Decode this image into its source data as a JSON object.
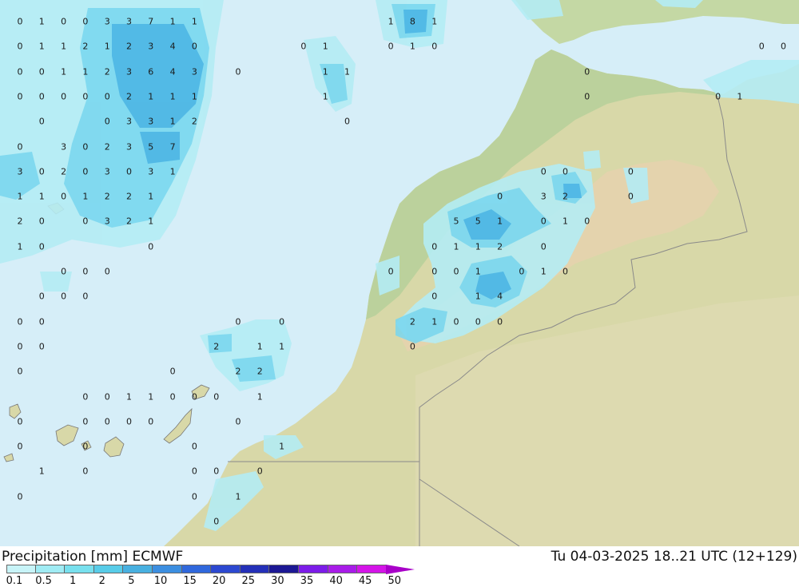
{
  "footer": {
    "title": "Precipitation [mm] ECMWF",
    "datetime": "Tu 04-03-2025 18..21 UTC (12+129)"
  },
  "colors": {
    "sea": "#d6eef8",
    "land": "#d8d8a8",
    "land_green": "#b8d09a",
    "mountain": "#e6d2ae",
    "border": "#8a8a8a"
  },
  "legend": {
    "ticks": [
      "0.1",
      "0.5",
      "1",
      "2",
      "5",
      "10",
      "15",
      "20",
      "25",
      "30",
      "35",
      "40",
      "45",
      "50"
    ],
    "colors": [
      "#c8f4f8",
      "#a0ecf4",
      "#78e0ee",
      "#58cce8",
      "#48b0e0",
      "#3c8ee0",
      "#3068dc",
      "#2c48d0",
      "#2430b8",
      "#1c1894",
      "#7c1ce8",
      "#a81ce8",
      "#d414e8",
      "#ec10d8",
      "#b010b0"
    ]
  },
  "grid_values": [
    {
      "v": "0",
      "row": 0,
      "col": 0
    },
    {
      "v": "1",
      "row": 0,
      "col": 1
    },
    {
      "v": "0",
      "row": 0,
      "col": 2
    },
    {
      "v": "0",
      "row": 0,
      "col": 3
    },
    {
      "v": "3",
      "row": 0,
      "col": 4
    },
    {
      "v": "3",
      "row": 0,
      "col": 5
    },
    {
      "v": "7",
      "row": 0,
      "col": 6
    },
    {
      "v": "1",
      "row": 0,
      "col": 7
    },
    {
      "v": "1",
      "row": 0,
      "col": 8
    },
    {
      "v": "1",
      "row": 0,
      "col": 17
    },
    {
      "v": "8",
      "row": 0,
      "col": 18
    },
    {
      "v": "1",
      "row": 0,
      "col": 19
    },
    {
      "v": "0",
      "row": 1,
      "col": 0
    },
    {
      "v": "1",
      "row": 1,
      "col": 1
    },
    {
      "v": "1",
      "row": 1,
      "col": 2
    },
    {
      "v": "2",
      "row": 1,
      "col": 3
    },
    {
      "v": "1",
      "row": 1,
      "col": 4
    },
    {
      "v": "2",
      "row": 1,
      "col": 5
    },
    {
      "v": "3",
      "row": 1,
      "col": 6
    },
    {
      "v": "4",
      "row": 1,
      "col": 7
    },
    {
      "v": "0",
      "row": 1,
      "col": 8
    },
    {
      "v": "0",
      "row": 1,
      "col": 13
    },
    {
      "v": "1",
      "row": 1,
      "col": 14
    },
    {
      "v": "0",
      "row": 1,
      "col": 17
    },
    {
      "v": "1",
      "row": 1,
      "col": 18
    },
    {
      "v": "0",
      "row": 1,
      "col": 19
    },
    {
      "v": "0",
      "row": 1,
      "col": 34
    },
    {
      "v": "0",
      "row": 1,
      "col": 35
    },
    {
      "v": "0",
      "row": 2,
      "col": 0
    },
    {
      "v": "0",
      "row": 2,
      "col": 1
    },
    {
      "v": "1",
      "row": 2,
      "col": 2
    },
    {
      "v": "1",
      "row": 2,
      "col": 3
    },
    {
      "v": "2",
      "row": 2,
      "col": 4
    },
    {
      "v": "3",
      "row": 2,
      "col": 5
    },
    {
      "v": "6",
      "row": 2,
      "col": 6
    },
    {
      "v": "4",
      "row": 2,
      "col": 7
    },
    {
      "v": "3",
      "row": 2,
      "col": 8
    },
    {
      "v": "0",
      "row": 2,
      "col": 10
    },
    {
      "v": "1",
      "row": 2,
      "col": 14
    },
    {
      "v": "1",
      "row": 2,
      "col": 15
    },
    {
      "v": "0",
      "row": 2,
      "col": 26
    },
    {
      "v": "0",
      "row": 3,
      "col": 0
    },
    {
      "v": "0",
      "row": 3,
      "col": 1
    },
    {
      "v": "0",
      "row": 3,
      "col": 2
    },
    {
      "v": "0",
      "row": 3,
      "col": 3
    },
    {
      "v": "0",
      "row": 3,
      "col": 4
    },
    {
      "v": "2",
      "row": 3,
      "col": 5
    },
    {
      "v": "1",
      "row": 3,
      "col": 6
    },
    {
      "v": "1",
      "row": 3,
      "col": 7
    },
    {
      "v": "1",
      "row": 3,
      "col": 8
    },
    {
      "v": "1",
      "row": 3,
      "col": 14
    },
    {
      "v": "0",
      "row": 3,
      "col": 26
    },
    {
      "v": "0",
      "row": 3,
      "col": 32
    },
    {
      "v": "1",
      "row": 3,
      "col": 33
    },
    {
      "v": "0",
      "row": 4,
      "col": 1
    },
    {
      "v": "0",
      "row": 4,
      "col": 4
    },
    {
      "v": "3",
      "row": 4,
      "col": 5
    },
    {
      "v": "3",
      "row": 4,
      "col": 6
    },
    {
      "v": "1",
      "row": 4,
      "col": 7
    },
    {
      "v": "2",
      "row": 4,
      "col": 8
    },
    {
      "v": "0",
      "row": 4,
      "col": 15
    },
    {
      "v": "0",
      "row": 5,
      "col": 0
    },
    {
      "v": "3",
      "row": 5,
      "col": 2
    },
    {
      "v": "0",
      "row": 5,
      "col": 3
    },
    {
      "v": "2",
      "row": 5,
      "col": 4
    },
    {
      "v": "3",
      "row": 5,
      "col": 5
    },
    {
      "v": "5",
      "row": 5,
      "col": 6
    },
    {
      "v": "7",
      "row": 5,
      "col": 7
    },
    {
      "v": "3",
      "row": 6,
      "col": 0
    },
    {
      "v": "0",
      "row": 6,
      "col": 1
    },
    {
      "v": "2",
      "row": 6,
      "col": 2
    },
    {
      "v": "0",
      "row": 6,
      "col": 3
    },
    {
      "v": "3",
      "row": 6,
      "col": 4
    },
    {
      "v": "0",
      "row": 6,
      "col": 5
    },
    {
      "v": "3",
      "row": 6,
      "col": 6
    },
    {
      "v": "1",
      "row": 6,
      "col": 7
    },
    {
      "v": "0",
      "row": 6,
      "col": 24
    },
    {
      "v": "0",
      "row": 6,
      "col": 25
    },
    {
      "v": "0",
      "row": 6,
      "col": 28
    },
    {
      "v": "1",
      "row": 7,
      "col": 0
    },
    {
      "v": "1",
      "row": 7,
      "col": 1
    },
    {
      "v": "0",
      "row": 7,
      "col": 2
    },
    {
      "v": "1",
      "row": 7,
      "col": 3
    },
    {
      "v": "2",
      "row": 7,
      "col": 4
    },
    {
      "v": "2",
      "row": 7,
      "col": 5
    },
    {
      "v": "1",
      "row": 7,
      "col": 6
    },
    {
      "v": "0",
      "row": 7,
      "col": 22
    },
    {
      "v": "3",
      "row": 7,
      "col": 24
    },
    {
      "v": "2",
      "row": 7,
      "col": 25
    },
    {
      "v": "0",
      "row": 7,
      "col": 28
    },
    {
      "v": "2",
      "row": 8,
      "col": 0
    },
    {
      "v": "0",
      "row": 8,
      "col": 1
    },
    {
      "v": "0",
      "row": 8,
      "col": 3
    },
    {
      "v": "3",
      "row": 8,
      "col": 4
    },
    {
      "v": "2",
      "row": 8,
      "col": 5
    },
    {
      "v": "1",
      "row": 8,
      "col": 6
    },
    {
      "v": "5",
      "row": 8,
      "col": 20
    },
    {
      "v": "5",
      "row": 8,
      "col": 21
    },
    {
      "v": "1",
      "row": 8,
      "col": 22
    },
    {
      "v": "0",
      "row": 8,
      "col": 24
    },
    {
      "v": "1",
      "row": 8,
      "col": 25
    },
    {
      "v": "0",
      "row": 8,
      "col": 26
    },
    {
      "v": "1",
      "row": 9,
      "col": 0
    },
    {
      "v": "0",
      "row": 9,
      "col": 1
    },
    {
      "v": "0",
      "row": 9,
      "col": 6
    },
    {
      "v": "0",
      "row": 9,
      "col": 19
    },
    {
      "v": "1",
      "row": 9,
      "col": 20
    },
    {
      "v": "1",
      "row": 9,
      "col": 21
    },
    {
      "v": "2",
      "row": 9,
      "col": 22
    },
    {
      "v": "0",
      "row": 9,
      "col": 24
    },
    {
      "v": "0",
      "row": 10,
      "col": 2
    },
    {
      "v": "0",
      "row": 10,
      "col": 3
    },
    {
      "v": "0",
      "row": 10,
      "col": 4
    },
    {
      "v": "0",
      "row": 10,
      "col": 17
    },
    {
      "v": "0",
      "row": 10,
      "col": 19
    },
    {
      "v": "0",
      "row": 10,
      "col": 20
    },
    {
      "v": "1",
      "row": 10,
      "col": 21
    },
    {
      "v": "0",
      "row": 10,
      "col": 23
    },
    {
      "v": "1",
      "row": 10,
      "col": 24
    },
    {
      "v": "0",
      "row": 10,
      "col": 25
    },
    {
      "v": "0",
      "row": 11,
      "col": 1
    },
    {
      "v": "0",
      "row": 11,
      "col": 2
    },
    {
      "v": "0",
      "row": 11,
      "col": 3
    },
    {
      "v": "0",
      "row": 11,
      "col": 19
    },
    {
      "v": "1",
      "row": 11,
      "col": 21
    },
    {
      "v": "4",
      "row": 11,
      "col": 22
    },
    {
      "v": "0",
      "row": 12,
      "col": 0
    },
    {
      "v": "0",
      "row": 12,
      "col": 1
    },
    {
      "v": "0",
      "row": 12,
      "col": 10
    },
    {
      "v": "0",
      "row": 12,
      "col": 12
    },
    {
      "v": "2",
      "row": 12,
      "col": 18
    },
    {
      "v": "1",
      "row": 12,
      "col": 19
    },
    {
      "v": "0",
      "row": 12,
      "col": 20
    },
    {
      "v": "0",
      "row": 12,
      "col": 21
    },
    {
      "v": "0",
      "row": 12,
      "col": 22
    },
    {
      "v": "0",
      "row": 13,
      "col": 0
    },
    {
      "v": "0",
      "row": 13,
      "col": 1
    },
    {
      "v": "2",
      "row": 13,
      "col": 9
    },
    {
      "v": "1",
      "row": 13,
      "col": 11
    },
    {
      "v": "1",
      "row": 13,
      "col": 12
    },
    {
      "v": "0",
      "row": 13,
      "col": 18
    },
    {
      "v": "0",
      "row": 14,
      "col": 0
    },
    {
      "v": "0",
      "row": 14,
      "col": 7
    },
    {
      "v": "2",
      "row": 14,
      "col": 10
    },
    {
      "v": "2",
      "row": 14,
      "col": 11
    },
    {
      "v": "0",
      "row": 15,
      "col": 3
    },
    {
      "v": "0",
      "row": 15,
      "col": 4
    },
    {
      "v": "1",
      "row": 15,
      "col": 5
    },
    {
      "v": "1",
      "row": 15,
      "col": 6
    },
    {
      "v": "0",
      "row": 15,
      "col": 7
    },
    {
      "v": "0",
      "row": 15,
      "col": 8
    },
    {
      "v": "0",
      "row": 15,
      "col": 9
    },
    {
      "v": "1",
      "row": 15,
      "col": 11
    },
    {
      "v": "0",
      "row": 16,
      "col": 0
    },
    {
      "v": "0",
      "row": 16,
      "col": 3
    },
    {
      "v": "0",
      "row": 16,
      "col": 4
    },
    {
      "v": "0",
      "row": 16,
      "col": 5
    },
    {
      "v": "0",
      "row": 16,
      "col": 6
    },
    {
      "v": "0",
      "row": 16,
      "col": 10
    },
    {
      "v": "0",
      "row": 17,
      "col": 0
    },
    {
      "v": "0",
      "row": 17,
      "col": 3
    },
    {
      "v": "0",
      "row": 17,
      "col": 8
    },
    {
      "v": "1",
      "row": 17,
      "col": 12
    },
    {
      "v": "1",
      "row": 18,
      "col": 1
    },
    {
      "v": "0",
      "row": 18,
      "col": 3
    },
    {
      "v": "0",
      "row": 18,
      "col": 8
    },
    {
      "v": "0",
      "row": 18,
      "col": 9
    },
    {
      "v": "0",
      "row": 18,
      "col": 11
    },
    {
      "v": "0",
      "row": 19,
      "col": 0
    },
    {
      "v": "0",
      "row": 19,
      "col": 8
    },
    {
      "v": "1",
      "row": 19,
      "col": 10
    },
    {
      "v": "0",
      "row": 20,
      "col": 9
    }
  ]
}
